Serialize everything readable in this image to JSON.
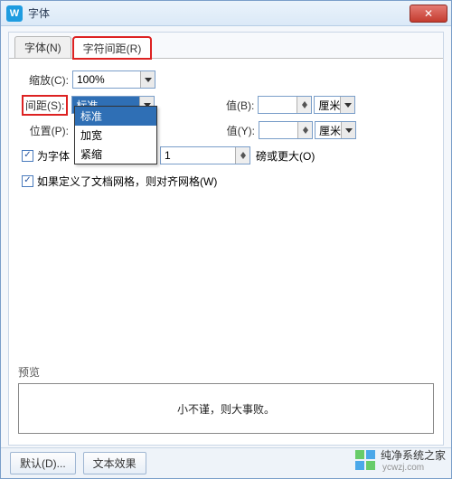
{
  "window": {
    "title": "字体"
  },
  "tabs": {
    "items": [
      {
        "label": "字体(N)"
      },
      {
        "label": "字符间距(R)"
      }
    ],
    "active": 1,
    "highlight": 1
  },
  "form": {
    "scale": {
      "label": "缩放(C):",
      "value": "100%"
    },
    "spacing": {
      "label": "间距(S):",
      "value": "标准",
      "options": [
        "标准",
        "加宽",
        "紧缩"
      ],
      "val_b_label": "值(B):",
      "val_b": "",
      "unit_b": "厘米"
    },
    "position": {
      "label": "位置(P):",
      "value": "",
      "val_y_label": "值(Y):",
      "val_y": "",
      "unit_y": "厘米"
    },
    "kerning": {
      "checked": true,
      "label": "为字体",
      "spin": "1",
      "tail": "磅或更大(O)"
    },
    "snap": {
      "checked": true,
      "label": "如果定义了文档网格，则对齐网格(W)"
    }
  },
  "preview": {
    "label": "预览",
    "text": "小不谨，则大事败。"
  },
  "footer": {
    "default_btn": "默认(D)...",
    "effects_btn": "文本效果"
  },
  "watermark": {
    "brand": "纯净系统之家",
    "url": "ycwzj.com"
  }
}
